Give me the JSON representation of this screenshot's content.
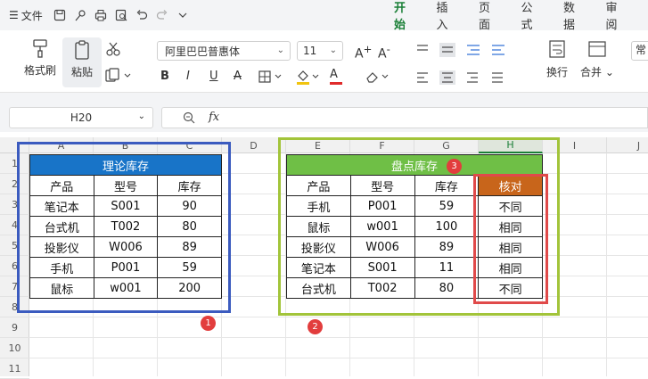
{
  "menubar": {
    "file_label": "文件",
    "tabs": [
      {
        "label": "开始",
        "active": true
      },
      {
        "label": "插入",
        "active": false
      },
      {
        "label": "页面",
        "active": false
      },
      {
        "label": "公式",
        "active": false
      },
      {
        "label": "数据",
        "active": false
      },
      {
        "label": "审阅",
        "active": false
      }
    ]
  },
  "ribbon": {
    "format_painter": "格式刷",
    "paste": "粘贴",
    "font_name": "阿里巴巴普惠体",
    "font_size": "11",
    "wrap": "换行",
    "merge": "合并",
    "bold": "B",
    "italic": "I",
    "underline": "U",
    "strike": "A",
    "font_color": "A",
    "grow": "A",
    "shrink": "A",
    "partial": "常"
  },
  "formula_bar": {
    "name_box": "H20",
    "fx": "fx",
    "formula": ""
  },
  "sheet": {
    "columns": [
      "A",
      "B",
      "C",
      "D",
      "E",
      "F",
      "G",
      "H",
      "I",
      "J"
    ],
    "rows": [
      "1",
      "2",
      "3",
      "4",
      "5",
      "6",
      "7",
      "8",
      "9",
      "10",
      "11"
    ],
    "selected_column": "H"
  },
  "table1": {
    "title": "理论库存",
    "headers": [
      "产品",
      "型号",
      "库存"
    ],
    "rows": [
      [
        "笔记本",
        "S001",
        "90"
      ],
      [
        "台式机",
        "T002",
        "80"
      ],
      [
        "投影仪",
        "W006",
        "89"
      ],
      [
        "手机",
        "P001",
        "59"
      ],
      [
        "鼠标",
        "w001",
        "200"
      ]
    ]
  },
  "table2": {
    "title": "盘点库存",
    "headers": [
      "产品",
      "型号",
      "库存",
      "核对"
    ],
    "rows": [
      [
        "手机",
        "P001",
        "59",
        "不同"
      ],
      [
        "鼠标",
        "w001",
        "100",
        "相同"
      ],
      [
        "投影仪",
        "W006",
        "89",
        "相同"
      ],
      [
        "笔记本",
        "S001",
        "11",
        "相同"
      ],
      [
        "台式机",
        "T002",
        "80",
        "不同"
      ]
    ]
  },
  "badges": [
    "1",
    "2",
    "3"
  ],
  "colors": {
    "blue_box": "#3b5bbf",
    "green_box": "#a2c43a",
    "red_box": "#e04a4a",
    "title_blue": "#1874c8",
    "title_green": "#6fbf46",
    "header_orange": "#c8651b",
    "accent": "#1a7f37"
  }
}
